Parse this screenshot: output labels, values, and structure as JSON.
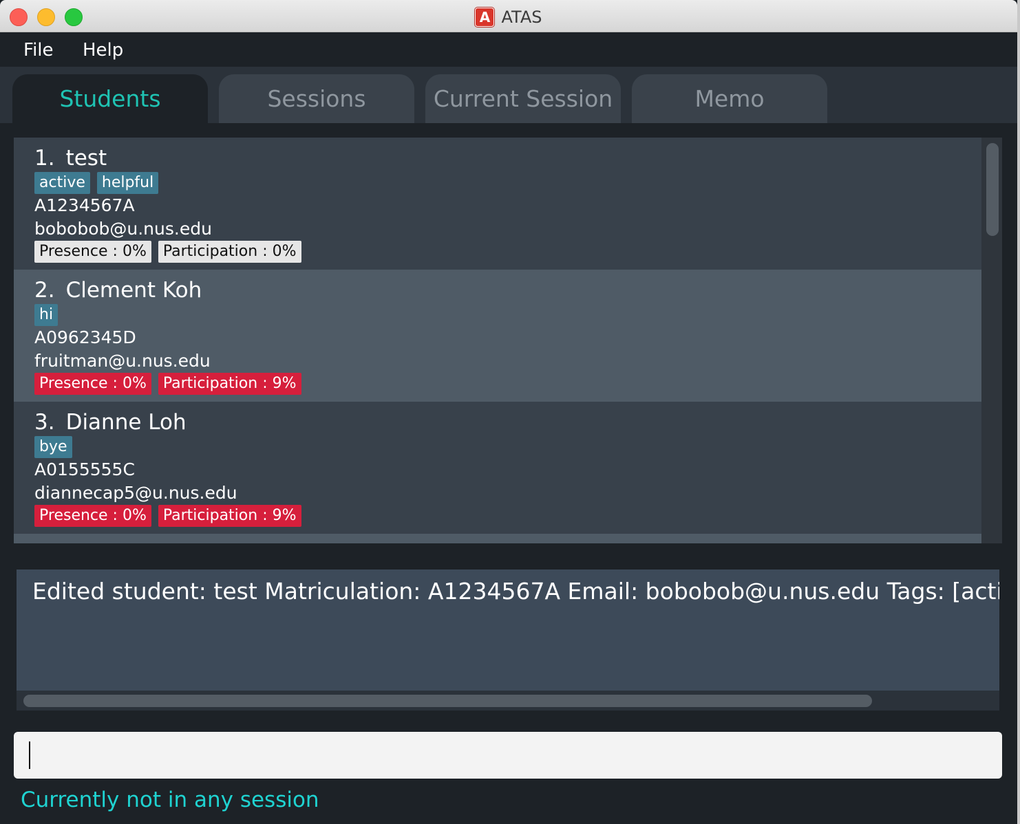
{
  "window": {
    "title": "ATAS",
    "app_icon_letter": "A"
  },
  "menu": {
    "items": [
      "File",
      "Help"
    ]
  },
  "tabs": [
    {
      "label": "Students",
      "active": true
    },
    {
      "label": "Sessions",
      "active": false
    },
    {
      "label": "Current Session",
      "active": false
    },
    {
      "label": "Memo",
      "active": false
    }
  ],
  "students": [
    {
      "index": "1.",
      "name": "test",
      "tags": [
        "active",
        "helpful"
      ],
      "matric": "A1234567A",
      "email": "bobobob@u.nus.edu",
      "presence": "Presence : 0%",
      "participation": "Participation : 0%"
    },
    {
      "index": "2.",
      "name": "Clement Koh",
      "tags": [
        "hi"
      ],
      "matric": "A0962345D",
      "email": "fruitman@u.nus.edu",
      "presence": "Presence : 0%",
      "participation": "Participation : 9%"
    },
    {
      "index": "3.",
      "name": "Dianne Loh",
      "tags": [
        "bye"
      ],
      "matric": "A0155555C",
      "email": "diannecap5@u.nus.edu",
      "presence": "Presence : 0%",
      "participation": "Participation : 9%"
    }
  ],
  "result_display": {
    "text": "Edited student: test Matriculation: A1234567A Email: bobobob@u.nus.edu Tags: [active][helpful]"
  },
  "command_box": {
    "value": "",
    "placeholder": ""
  },
  "status_bar": {
    "text": "Currently not in any session"
  },
  "colors": {
    "accent": "#1fc3b3",
    "tag_bg": "#3e7b91",
    "warn_bg": "#d61f3c",
    "ok_bg": "#e6e6e6",
    "status_text": "#1fd3d1"
  }
}
